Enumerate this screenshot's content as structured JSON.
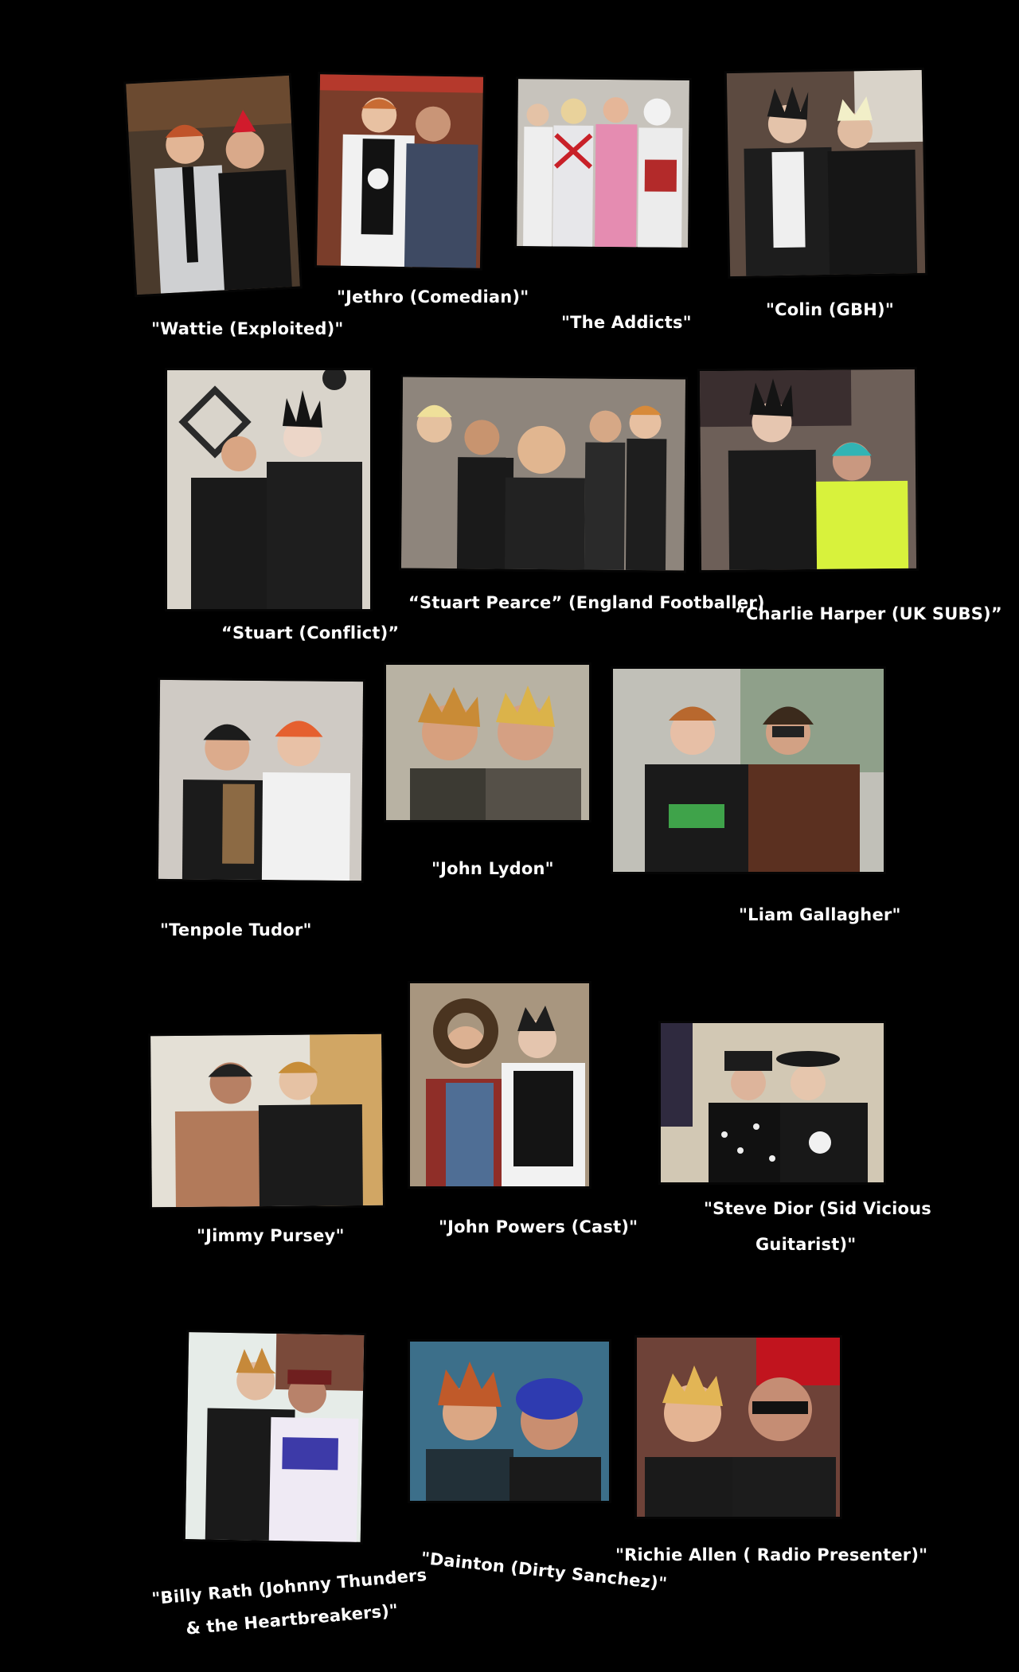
{
  "captions": {
    "wattie": "\"Wattie (Exploited)\"",
    "jethro": "\"Jethro (Comedian)\"",
    "addicts": "\"The Addicts\"",
    "colin": "\"Colin (GBH)\"",
    "stuart": "“Stuart    (Conflict)”",
    "stuart_pearce": "“Stuart Pearce” (England Footballer)",
    "charlie_harper": "“Charlie Harper (UK  SUBS)”",
    "tenpole": "\"Tenpole Tudor\"",
    "john_lydon": "\"John Lydon\"",
    "liam": "\"Liam Gallagher\"",
    "jimmy_pursey": "\"Jimmy Pursey\"",
    "john_powers": "\"John Powers (Cast)\"",
    "steve_dior_1": "\"Steve Dior (Sid Vicious",
    "steve_dior_2": "Guitarist)\"",
    "billy_rath_1": "\"Billy Rath (Johnny Thunders",
    "billy_rath_2": "& the Heartbreakers)\"",
    "dainton": "\"Dainton (Dirty Sanchez)\"",
    "richie_allen": "\"Richie Allen ( Radio Presenter)\""
  },
  "colors": {
    "background": "#000000",
    "caption": "#ffffff"
  }
}
